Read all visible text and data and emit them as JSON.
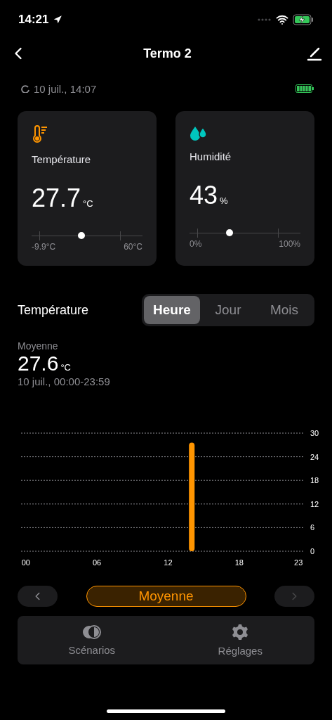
{
  "status_bar": {
    "time": "14:21"
  },
  "header": {
    "title": "Termo 2"
  },
  "sync": {
    "time": "10 juil., 14:07"
  },
  "cards": [
    {
      "kind": "temperature",
      "label": "Température",
      "value": "27.7",
      "unit": "°C",
      "level": 0.45,
      "min": "-9.9°C",
      "max": "60°C"
    },
    {
      "kind": "humidity",
      "label": "Humidité",
      "value": "43",
      "unit": "%",
      "level": 0.36,
      "min": "0%",
      "max": "100%"
    }
  ],
  "section": {
    "title": "Température",
    "tabs": [
      {
        "label": "Heure",
        "selected": true
      },
      {
        "label": "Jour",
        "selected": false
      },
      {
        "label": "Mois",
        "selected": false
      }
    ]
  },
  "summary": {
    "label": "Moyenne",
    "value": "27.6",
    "unit": "°C",
    "range": "10 juil., 00:00-23:59"
  },
  "chart_data": {
    "type": "bar",
    "x": [
      14
    ],
    "xlim": [
      -0.4,
      23.4
    ],
    "grid": true,
    "xticks": [
      {
        "value": 0,
        "label": "00"
      },
      {
        "value": 6,
        "label": "06"
      },
      {
        "value": 12,
        "label": "12"
      },
      {
        "value": 18,
        "label": "18"
      },
      {
        "value": 23,
        "label": "23"
      }
    ],
    "yticks": [
      0,
      6,
      12,
      18,
      24,
      30
    ],
    "ylim": [
      0,
      30
    ],
    "series": [
      {
        "color": "#ff9500",
        "values": [
          27.6
        ]
      }
    ]
  },
  "mode_button": {
    "label": "Moyenne"
  },
  "tab_bar": [
    {
      "kind": "scenarios",
      "label": "Scénarios"
    },
    {
      "kind": "settings",
      "label": "Réglages"
    }
  ]
}
